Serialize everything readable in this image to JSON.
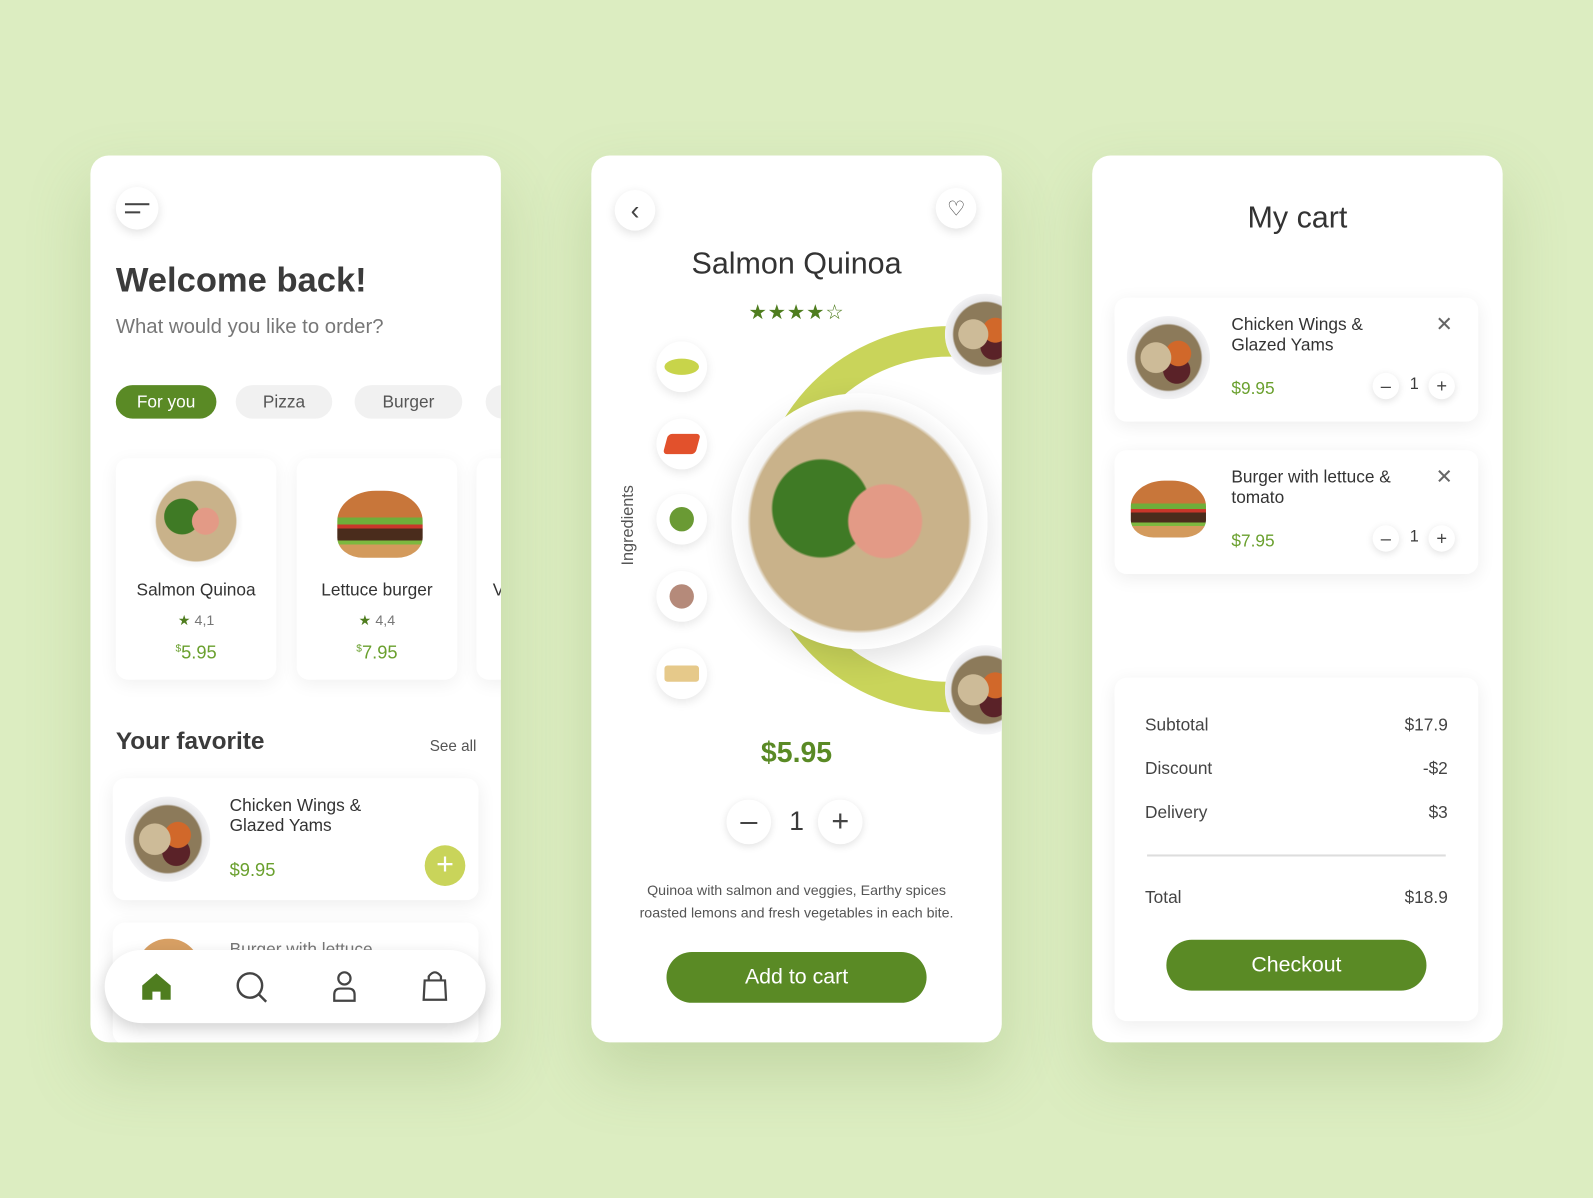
{
  "home": {
    "greeting": "Welcome back!",
    "subtitle": "What would you like to order?",
    "categories": [
      {
        "label": "For you",
        "active": true
      },
      {
        "label": "Pizza"
      },
      {
        "label": "Burger"
      }
    ],
    "products": [
      {
        "name": "Salmon Quinoa",
        "rating": "4,1",
        "currency": "$",
        "price": "5.95"
      },
      {
        "name": "Lettuce burger",
        "rating": "4,4",
        "currency": "$",
        "price": "7.95"
      },
      {
        "name": "V"
      }
    ],
    "favorite_title": "Your favorite",
    "see_all": "See all",
    "favorites": [
      {
        "name": "Chicken Wings & Glazed Yams",
        "price": "$9.95"
      },
      {
        "name": "Burger with lettuce"
      }
    ],
    "nav": [
      "home-icon",
      "search-icon",
      "profile-icon",
      "bag-icon"
    ]
  },
  "detail": {
    "title": "Salmon Quinoa",
    "rating": 4,
    "rating_max": 5,
    "ingredients_label": "Ingredients",
    "ingredients": [
      "lime",
      "salmon",
      "broccoli",
      "onion",
      "cheese"
    ],
    "price": "$5.95",
    "quantity": "1",
    "description": "Quinoa with salmon and veggies, Earthy spices roasted lemons and fresh vegetables in each bite.",
    "add_to_cart": "Add to cart"
  },
  "cart": {
    "title": "My cart",
    "items": [
      {
        "name": "Chicken Wings & Glazed Yams",
        "price": "$9.95",
        "qty": "1"
      },
      {
        "name": "Burger with lettuce & tomato",
        "price": "$7.95",
        "qty": "1"
      }
    ],
    "summary": [
      {
        "label": "Subtotal",
        "value": "$17.9"
      },
      {
        "label": "Discount",
        "value": "-$2"
      },
      {
        "label": "Delivery",
        "value": "$3"
      }
    ],
    "total_label": "Total",
    "total_value": "$18.9",
    "checkout": "Checkout"
  },
  "colors": {
    "brand": "#5a8a25",
    "accent": "#c9d45a",
    "price": "#6aa02e",
    "background": "#dcedc1"
  }
}
